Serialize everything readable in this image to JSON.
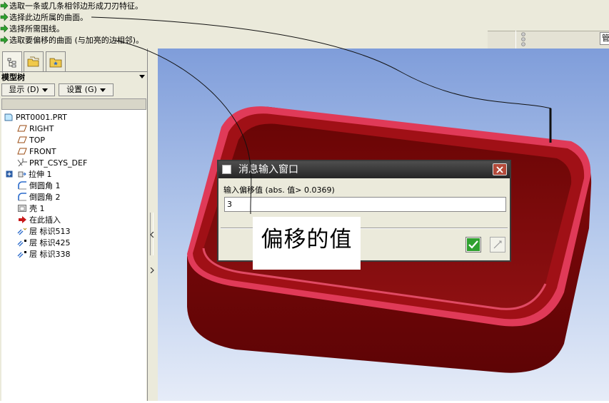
{
  "messages": [
    "选取一条或几条相邻边形成刀刃特征。",
    "选择此边所属的曲面。",
    "选择所需围线。",
    "选取要偏移的曲面 (与加亮的边相邻)。"
  ],
  "status_field_text": "管",
  "panel": {
    "tree_title": "模型树",
    "show_button": "显示 (D)",
    "settings_button": "设置 (G)"
  },
  "tree_items": [
    {
      "label": "PRT0001.PRT",
      "icon": "part-icon"
    },
    {
      "label": "RIGHT",
      "icon": "datum-plane-icon"
    },
    {
      "label": "TOP",
      "icon": "datum-plane-icon"
    },
    {
      "label": "FRONT",
      "icon": "datum-plane-icon"
    },
    {
      "label": "PRT_CSYS_DEF",
      "icon": "csys-icon"
    },
    {
      "label": "拉伸 1",
      "icon": "extrude-icon"
    },
    {
      "label": "倒圆角 1",
      "icon": "round-icon"
    },
    {
      "label": "倒圆角 2",
      "icon": "round-icon"
    },
    {
      "label": "壳 1",
      "icon": "shell-icon"
    },
    {
      "label": "在此插入",
      "icon": "insert-here-icon"
    },
    {
      "label": "层 标识513",
      "icon": "layer-icon"
    },
    {
      "label": "层 标识425",
      "icon": "layer-icon"
    },
    {
      "label": "层 标识338",
      "icon": "layer-icon"
    }
  ],
  "dialog": {
    "title": "消息输入窗口",
    "prompt": "输入偏移值 (abs. 值> 0.0369)",
    "value": "3"
  },
  "annotation": "偏移的值",
  "colors": {
    "model_dark": "#6e0506",
    "model_mid": "#8a0a0c",
    "model_rim": "#e03a58",
    "background_top": "#7f9dda",
    "background_bottom": "#e6ecf8",
    "ui_gray": "#ebeadb",
    "message_arrow": "#2fa12f"
  }
}
